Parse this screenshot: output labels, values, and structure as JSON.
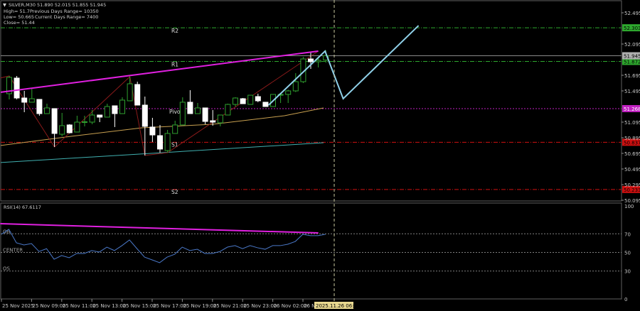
{
  "header": {
    "symbol_line": "SILVER,M30  51.890 52.015 51.855 51.945",
    "high": "High= 51.7",
    "prev_range": "Previous Days Range= 10350",
    "low": "Low= 50.665",
    "curr_range": "Current Days Range= 7400",
    "close": "Close= 51.44"
  },
  "colors": {
    "background": "#000000",
    "bull_outline": "#2fa02f",
    "bear_fill": "#ffffff",
    "trendline": "#e020e0",
    "zigzag": "#8b1a1a",
    "ma_slow": "#c8a050",
    "ma_fast": "#40b0b0",
    "projection": "#8fd0e8",
    "rsi_line": "#4a78c8",
    "resistance": "#2ea82e",
    "pivot": "#c020c0",
    "support": "#d01010"
  },
  "chart_data": [
    {
      "type": "candlestick",
      "title": "SILVER,M30",
      "y_ticks": [
        "52.495",
        "52.095",
        "51.695",
        "51.495",
        "51.095",
        "50.895",
        "50.695",
        "50.495",
        "50.295",
        "50.095"
      ],
      "ylim": [
        50.05,
        52.6
      ],
      "x_tick_labels": [
        "25 Nov 2025",
        "25 Nov 09:00",
        "25 Nov 11:00",
        "25 Nov 13:00",
        "25 Nov 15:00",
        "25 Nov 17:00",
        "25 Nov 19:00",
        "25 Nov 21:00",
        "25 Nov 23:00",
        "26 Nov 02:00",
        "26 No"
      ],
      "cursor_time_label": "2025.11.26 06:00",
      "current_price": "51.945",
      "candles_ohlc": [
        [
          51.459,
          51.686,
          51.386,
          51.668
        ],
        [
          51.659,
          51.686,
          51.386,
          51.404
        ],
        [
          51.404,
          51.495,
          51.222,
          51.35
        ],
        [
          51.35,
          51.522,
          51.35,
          51.395
        ],
        [
          51.386,
          51.386,
          51.177,
          51.204
        ],
        [
          51.204,
          51.331,
          51.204,
          51.277
        ],
        [
          51.268,
          51.268,
          50.777,
          50.95
        ],
        [
          50.94,
          51.213,
          50.913,
          51.05
        ],
        [
          51.059,
          51.068,
          50.95,
          50.959
        ],
        [
          50.968,
          51.177,
          50.968,
          51.095
        ],
        [
          51.095,
          51.177,
          51.041,
          51.1
        ],
        [
          51.095,
          51.25,
          51.068,
          51.186
        ],
        [
          51.186,
          51.186,
          51.095,
          51.159
        ],
        [
          51.159,
          51.331,
          51.159,
          51.295
        ],
        [
          51.304,
          51.304,
          51.032,
          51.204
        ],
        [
          51.204,
          51.413,
          51.204,
          51.377
        ],
        [
          51.368,
          51.677,
          51.368,
          51.586
        ],
        [
          51.577,
          51.613,
          51.313,
          51.313
        ],
        [
          51.313,
          51.422,
          50.668,
          51.041
        ],
        [
          51.032,
          51.15,
          50.841,
          50.931
        ],
        [
          50.922,
          51.059,
          50.704,
          50.75
        ],
        [
          50.731,
          50.995,
          50.704,
          50.95
        ],
        [
          50.95,
          51.113,
          50.95,
          51.059
        ],
        [
          51.059,
          51.413,
          51.059,
          51.35
        ],
        [
          51.35,
          51.504,
          51.204,
          51.204
        ],
        [
          51.204,
          51.34,
          51.204,
          51.277
        ],
        [
          51.277,
          51.277,
          51.068,
          51.104
        ],
        [
          51.113,
          51.25,
          51.05,
          51.095
        ],
        [
          51.086,
          51.186,
          51.041,
          51.186
        ],
        [
          51.186,
          51.331,
          51.186,
          51.322
        ],
        [
          51.322,
          51.413,
          51.295,
          51.404
        ],
        [
          51.395,
          51.404,
          51.331,
          51.331
        ],
        [
          51.322,
          51.44,
          51.322,
          51.44
        ],
        [
          51.422,
          51.459,
          51.35,
          51.368
        ],
        [
          51.35,
          51.35,
          51.295,
          51.295
        ],
        [
          51.295,
          51.45,
          51.295,
          51.45
        ],
        [
          51.44,
          51.45,
          51.34,
          51.45
        ],
        [
          51.45,
          51.51,
          51.34,
          51.495
        ],
        [
          51.495,
          51.722,
          51.48,
          51.613
        ],
        [
          51.613,
          51.931,
          51.595,
          51.904
        ],
        [
          51.904,
          52.0,
          51.777,
          51.868
        ],
        [
          51.868,
          51.931,
          51.795,
          51.886
        ],
        [
          51.89,
          52.015,
          51.855,
          51.945
        ]
      ],
      "levels": [
        {
          "name": "R2",
          "value": "52.303",
          "kind": "resistance"
        },
        {
          "name": "R1",
          "value": "51.872",
          "kind": "resistance"
        },
        {
          "name": "Pivot",
          "value": "51.268",
          "kind": "pivot"
        },
        {
          "name": "S1",
          "value": "50.837",
          "kind": "support"
        },
        {
          "name": "S2",
          "value": "50.233",
          "kind": "support"
        }
      ],
      "trendline": [
        [
          -1.2,
          51.477
        ],
        [
          41,
          52.004
        ]
      ],
      "zigzag": [
        [
          -1.2,
          51.66
        ],
        [
          0,
          51.686
        ],
        [
          6,
          50.777
        ],
        [
          16,
          51.677
        ],
        [
          18,
          50.668
        ],
        [
          21,
          50.704
        ],
        [
          41,
          52.004
        ]
      ],
      "ma_slow": [
        [
          -1.2,
          50.795
        ],
        [
          8.2,
          50.913
        ],
        [
          17.6,
          51.022
        ],
        [
          27,
          51.068
        ],
        [
          36.5,
          51.177
        ],
        [
          41.7,
          51.277
        ]
      ],
      "ma_fast": [
        [
          -1.2,
          50.577
        ],
        [
          41.7,
          50.831
        ]
      ],
      "projection": [
        [
          34.4,
          51.313
        ],
        [
          41.9,
          52.004
        ],
        [
          44.3,
          51.395
        ],
        [
          54.3,
          52.331
        ]
      ]
    },
    {
      "type": "line",
      "title": "RSI(14) 67.6117",
      "y_ticks": [
        "100",
        "70",
        "50",
        "30",
        "0"
      ],
      "ylim": [
        0,
        100
      ],
      "level_labels": [
        {
          "name": "OB",
          "value": 70
        },
        {
          "name": "CENTER",
          "value": 50
        },
        {
          "name": "OS",
          "value": 30
        }
      ],
      "values": [
        69.5,
        74.8,
        60.3,
        58,
        59.5,
        51,
        54,
        42.7,
        46.6,
        44.3,
        48.9,
        48.9,
        52,
        50.4,
        55.7,
        52,
        57.3,
        63.4,
        54,
        45,
        42,
        39,
        45,
        48,
        55.7,
        52,
        53.4,
        48.9,
        48.9,
        51,
        55.7,
        57.3,
        54,
        57.3,
        55,
        53.4,
        57.3,
        57.3,
        58.8,
        61.8,
        69.5,
        68,
        68,
        69.5
      ],
      "trendline": [
        [
          -1.2,
          80.9
        ],
        [
          41,
          71
        ]
      ]
    }
  ]
}
